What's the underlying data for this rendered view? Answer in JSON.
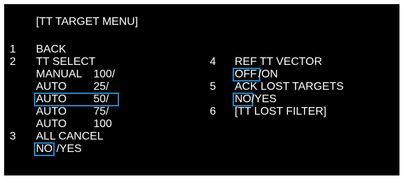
{
  "title": "[TT TARGET MENU]",
  "items": {
    "back": {
      "num": "1",
      "label": "BACK"
    },
    "tt_select": {
      "num": "2",
      "label": "TT SELECT",
      "options": [
        {
          "mode": "MANUAL",
          "value": "100/"
        },
        {
          "mode": "AUTO",
          "value": "25/"
        },
        {
          "mode": "AUTO",
          "value": "50/"
        },
        {
          "mode": "AUTO",
          "value": "75/"
        },
        {
          "mode": "AUTO",
          "value": "100"
        }
      ],
      "selected_index": 2
    },
    "all_cancel": {
      "num": "3",
      "label": "ALL CANCEL",
      "option_a": "NO",
      "option_b": " /YES",
      "selected": "NO"
    },
    "ref_tt_vector": {
      "num": "4",
      "label": "REF TT VECTOR",
      "option_a": "OFF",
      "option_b": "/ON",
      "selected": "OFF"
    },
    "ack_lost_targets": {
      "num": "5",
      "label": "ACK LOST TARGETS",
      "option_a": "NO",
      "option_b": "/YES",
      "selected": "NO"
    },
    "tt_lost_filter": {
      "num": "6",
      "label": "[TT LOST FILTER]"
    }
  },
  "colors": {
    "background": "#000000",
    "text": "#ffffff",
    "selection": "#1e88c9"
  }
}
